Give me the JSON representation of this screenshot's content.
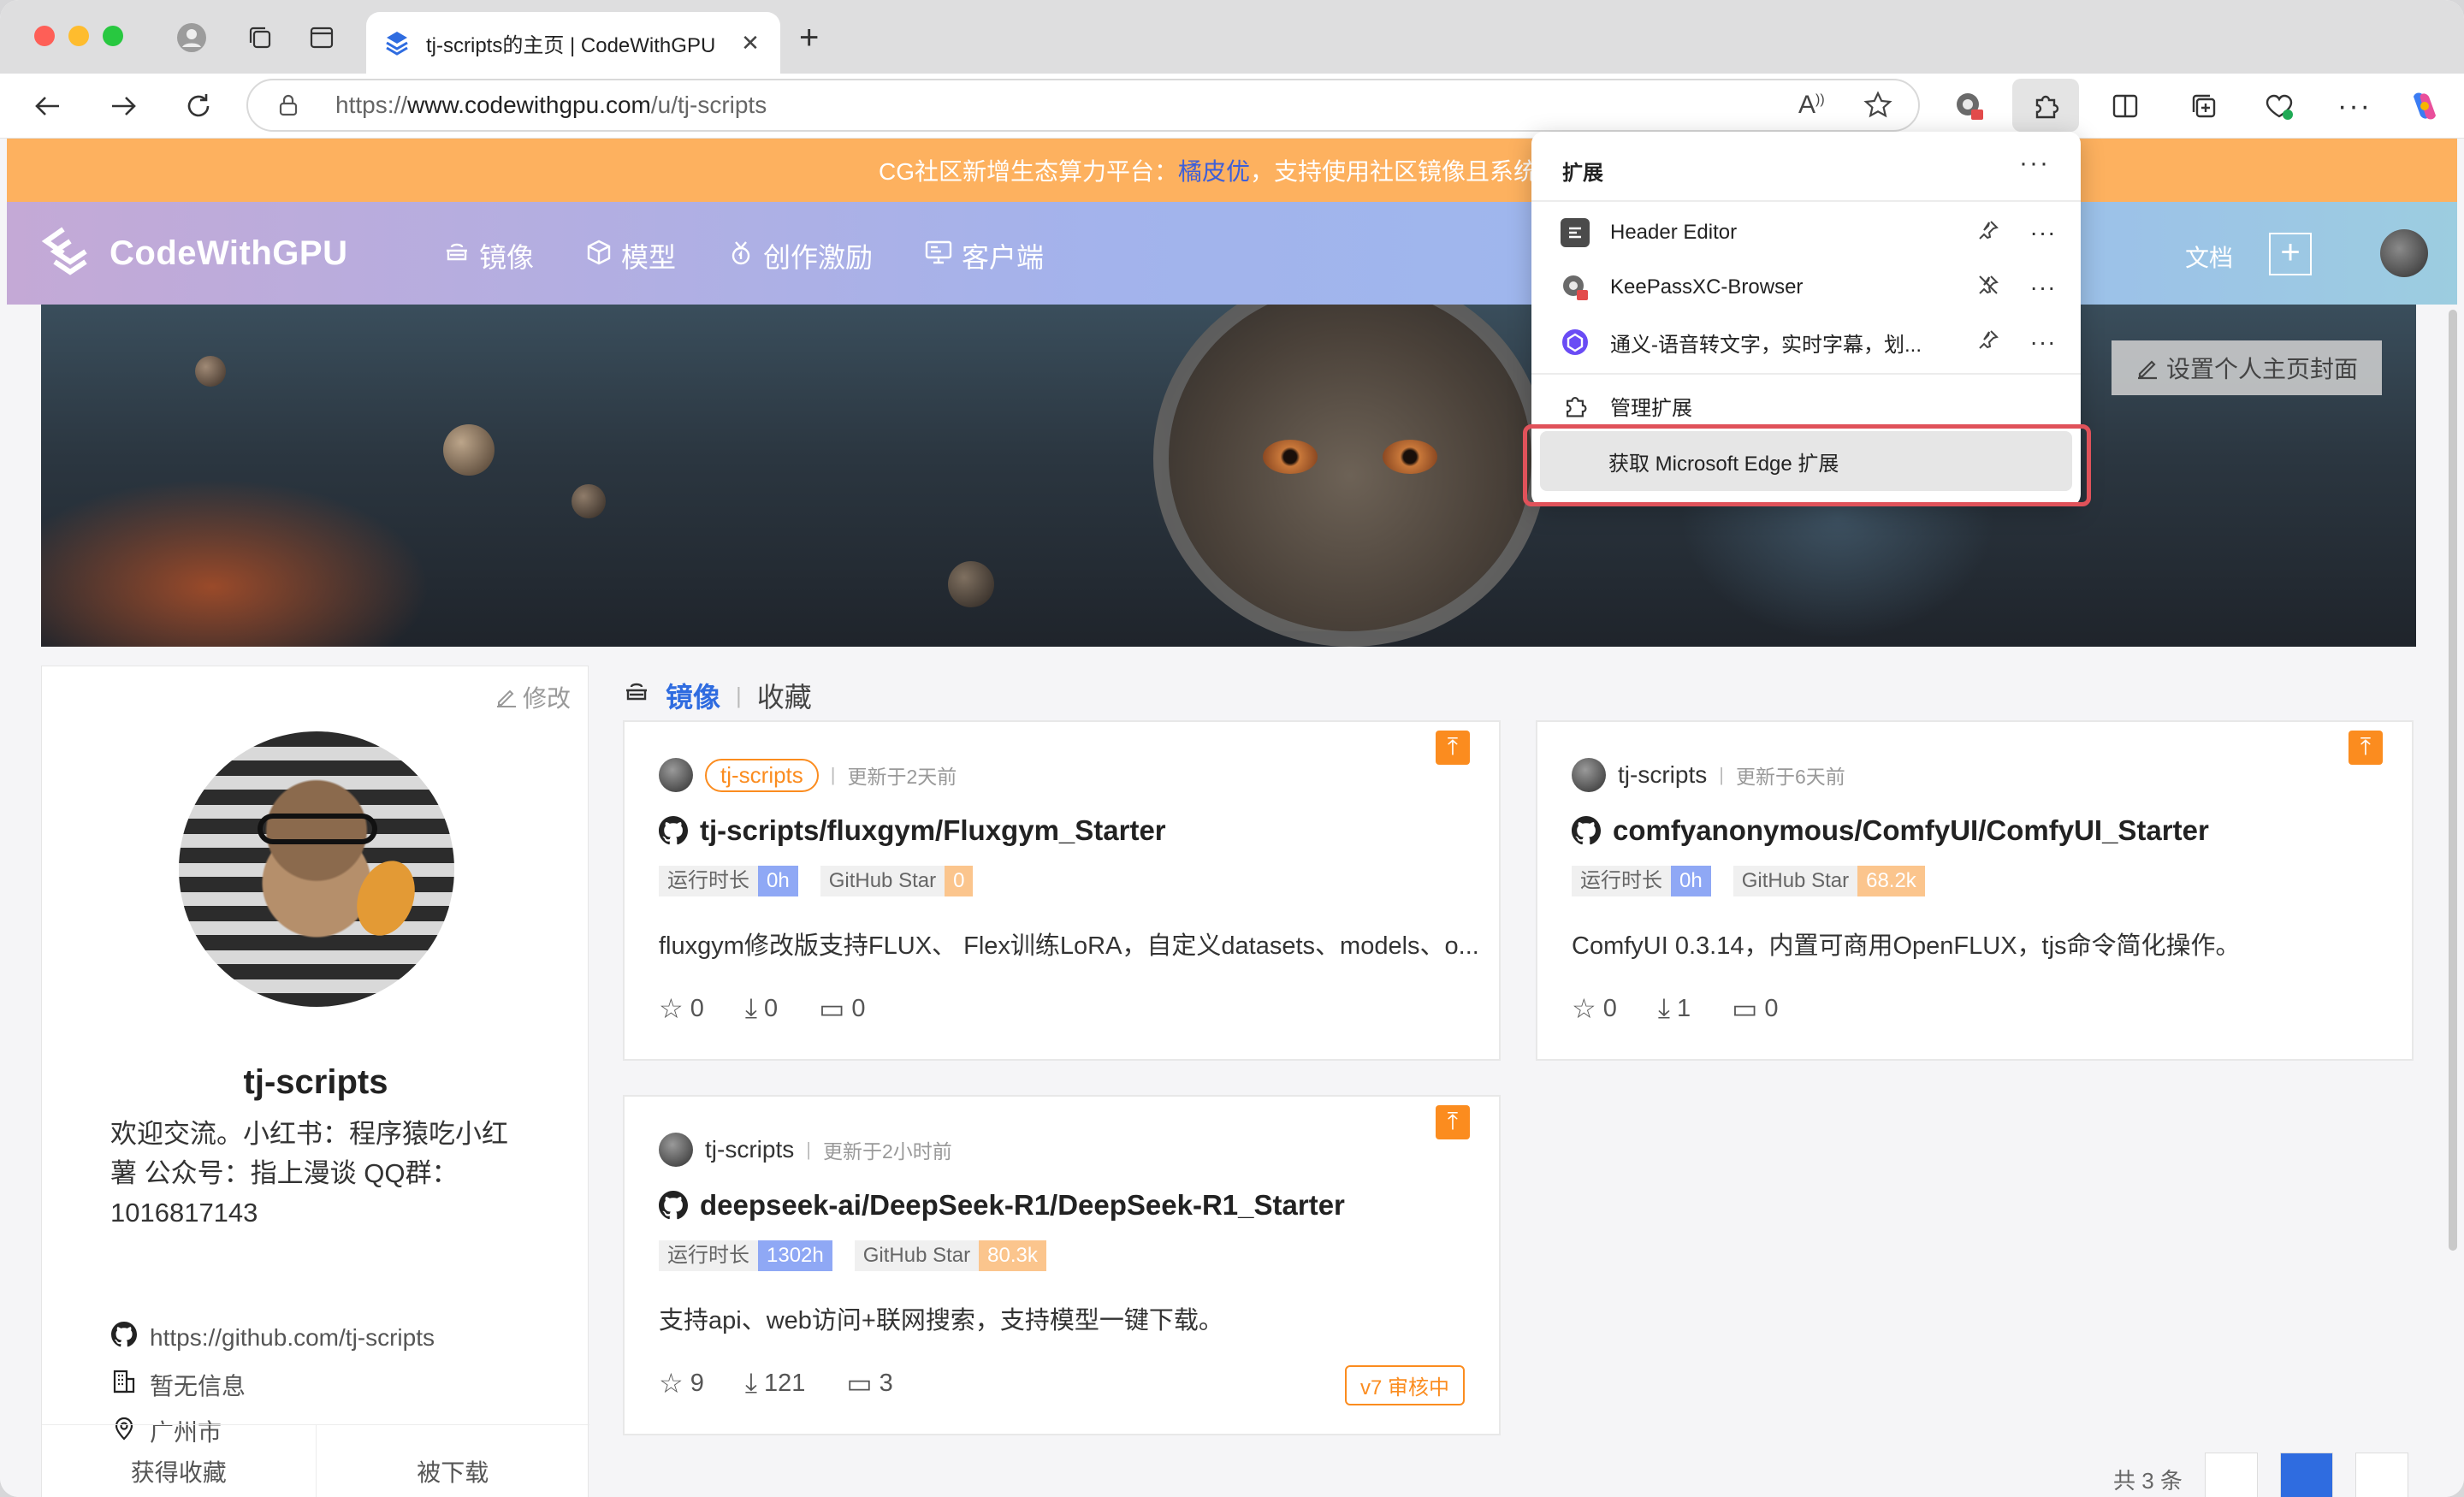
{
  "browser": {
    "tab": {
      "title": "tj-scripts的主页 | CodeWithGPU",
      "close": "✕"
    },
    "new_tab": "+",
    "url_prefix": "https://",
    "url_host": "www.codewithgpu.com",
    "url_path": "/u/tj-scripts"
  },
  "announcement": {
    "text_before": "CG社区新增生态算力平台：",
    "highlight": "橘皮优",
    "text_after": "，支持使用社区镜像且系统盘免"
  },
  "site": {
    "logo_text": "CodeWithGPU",
    "nav": [
      {
        "label": "镜像",
        "icon": "box-stack-icon"
      },
      {
        "label": "模型",
        "icon": "cube-icon"
      },
      {
        "label": "创作激励",
        "icon": "medal-icon"
      },
      {
        "label": "客户端",
        "icon": "desktop-icon"
      }
    ],
    "doc_label": "文档",
    "plus": "+"
  },
  "banner": {
    "cover_button": "设置个人主页封面"
  },
  "profile": {
    "edit_label": "修改",
    "name": "tj-scripts",
    "bio": "欢迎交流。小红书：程序猿吃小红薯 公众号：指上漫谈 QQ群：1016817143",
    "github": "https://github.com/tj-scripts",
    "company": "暂无信息",
    "location": "广州市",
    "stats": [
      "获得收藏",
      "被下载"
    ]
  },
  "content_tabs": {
    "active": "镜像",
    "separator": "|",
    "inactive": "收藏"
  },
  "repos": [
    {
      "owner": "tj-scripts",
      "owner_highlighted": true,
      "updated": "更新于2天前",
      "title": "tj-scripts/fluxgym/Fluxgym_Starter",
      "runtime_key": "运行时长",
      "runtime_val": "0h",
      "star_key": "GitHub Star",
      "star_val": "0",
      "desc": "fluxgym修改版支持FLUX、 Flex训练LoRA，自定义datasets、models、o...",
      "stars": "0",
      "downloads": "0",
      "comments": "0"
    },
    {
      "owner": "tj-scripts",
      "owner_highlighted": false,
      "updated": "更新于6天前",
      "title": "comfyanonymous/ComfyUI/ComfyUI_Starter",
      "runtime_key": "运行时长",
      "runtime_val": "0h",
      "star_key": "GitHub Star",
      "star_val": "68.2k",
      "desc": "ComfyUI 0.3.14，内置可商用OpenFLUX，tjs命令简化操作。",
      "stars": "0",
      "downloads": "1",
      "comments": "0"
    },
    {
      "owner": "tj-scripts",
      "owner_highlighted": false,
      "updated": "更新于2小时前",
      "title": "deepseek-ai/DeepSeek-R1/DeepSeek-R1_Starter",
      "runtime_key": "运行时长",
      "runtime_val": "1302h",
      "star_key": "GitHub Star",
      "star_val": "80.3k",
      "desc": "支持api、web访问+联网搜索，支持模型一键下载。",
      "stars": "9",
      "downloads": "121",
      "comments": "3",
      "review_badge": "v7 审核中"
    }
  ],
  "pager": {
    "count": "共 3 条"
  },
  "extensions_popup": {
    "title": "扩展",
    "more": "···",
    "items": [
      {
        "name": "Header Editor",
        "icon": "header-editor-icon",
        "pinned": true
      },
      {
        "name": "KeePassXC-Browser",
        "icon": "keepassxc-icon",
        "pinned": false
      },
      {
        "name": "通义-语音转文字，实时字幕，划...",
        "icon": "tongyi-icon",
        "pinned": true
      }
    ],
    "manage": "管理扩展",
    "get": "获取 Microsoft Edge 扩展"
  },
  "colors": {
    "accent_blue": "#2f6ce0",
    "orange": "#fb8c1f",
    "announce_bg": "#fdb15f",
    "highlight_red": "#e0525a"
  }
}
